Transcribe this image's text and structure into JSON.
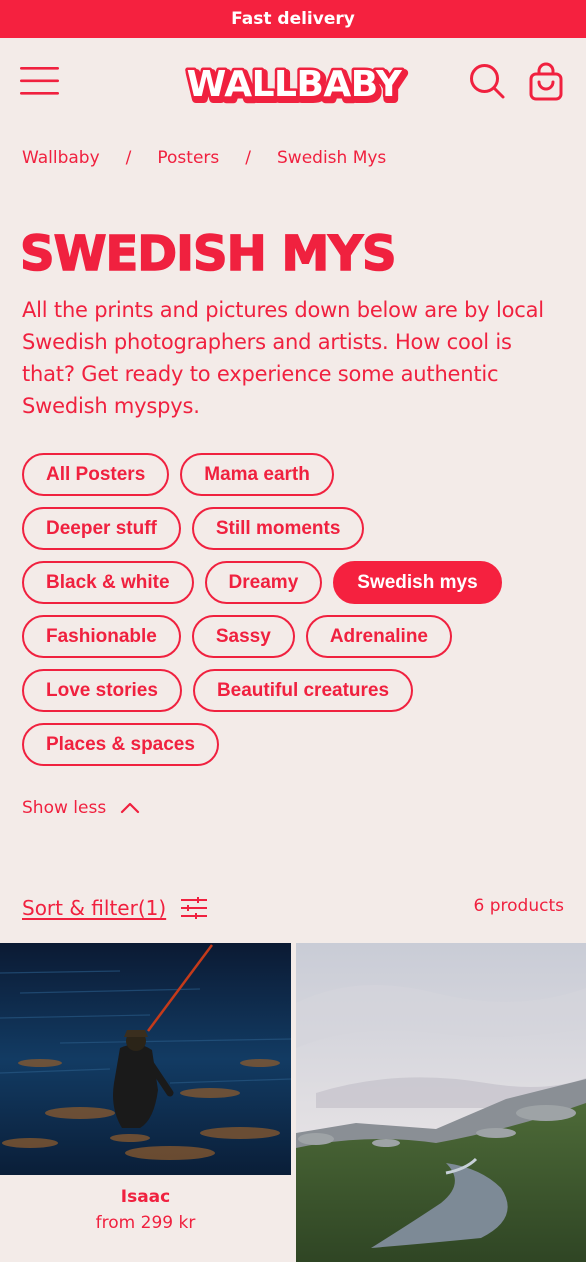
{
  "announcement": "Fast delivery",
  "header": {
    "logo_text": "WALLBABY",
    "menu_icon": "hamburger-icon",
    "search_icon": "search-icon",
    "cart_icon": "bag-icon"
  },
  "breadcrumb": {
    "items": [
      "Wallbaby",
      "Posters",
      "Swedish Mys"
    ],
    "separator": "/"
  },
  "page": {
    "title": "SWEDISH MYS",
    "description": "All the prints and pictures down below are by local Swedish photographers and artists. How cool is that? Get ready to experience some authentic Swedish myspys."
  },
  "tags": [
    {
      "label": "All Posters",
      "active": false
    },
    {
      "label": "Mama earth",
      "active": false
    },
    {
      "label": "Deeper stuff",
      "active": false
    },
    {
      "label": "Still moments",
      "active": false
    },
    {
      "label": "Black & white",
      "active": false
    },
    {
      "label": "Dreamy",
      "active": false
    },
    {
      "label": "Swedish mys",
      "active": true
    },
    {
      "label": "Fashionable",
      "active": false
    },
    {
      "label": "Sassy",
      "active": false
    },
    {
      "label": "Adrenaline",
      "active": false
    },
    {
      "label": "Love stories",
      "active": false
    },
    {
      "label": "Beautiful creatures",
      "active": false
    },
    {
      "label": "Places & spaces",
      "active": false
    }
  ],
  "show_less": "Show less",
  "toolbar": {
    "sort_filter_label": "Sort & filter(1)",
    "product_count": "6 products"
  },
  "products": [
    {
      "name": "Isaac",
      "price": "from 299 kr"
    }
  ],
  "colors": {
    "brand_red": "#f5213f",
    "background": "#f3ebe8"
  }
}
